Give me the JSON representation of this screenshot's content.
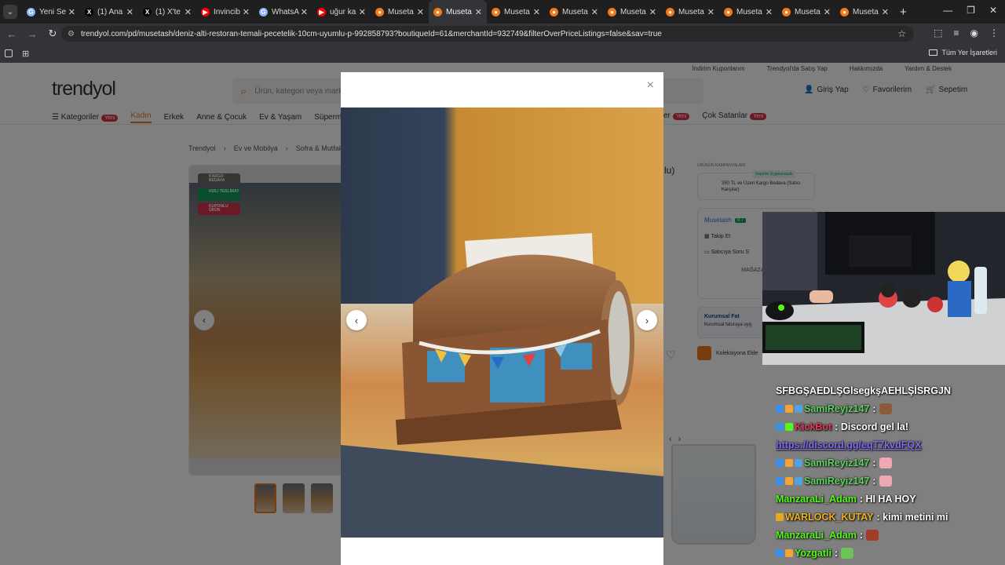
{
  "browser": {
    "tabs": [
      {
        "label": "Yeni Se",
        "fav_color": "#8ab4f8",
        "fav": "G"
      },
      {
        "label": "(1) Ana",
        "fav_color": "#000000",
        "fav": "X"
      },
      {
        "label": "(1) X'te",
        "fav_color": "#000000",
        "fav": "X"
      },
      {
        "label": "Invincib",
        "fav_color": "#ff0000",
        "fav": "▶"
      },
      {
        "label": "WhatsA",
        "fav_color": "#8ab4f8",
        "fav": "G"
      },
      {
        "label": "uğur ka",
        "fav_color": "#ff0000",
        "fav": "▶"
      },
      {
        "label": "Museta",
        "fav_color": "#f27a1a",
        "fav": "●"
      },
      {
        "label": "Museta",
        "fav_color": "#f27a1a",
        "fav": "●",
        "active": true
      },
      {
        "label": "Museta",
        "fav_color": "#f27a1a",
        "fav": "●"
      },
      {
        "label": "Museta",
        "fav_color": "#f27a1a",
        "fav": "●"
      },
      {
        "label": "Museta",
        "fav_color": "#f27a1a",
        "fav": "●"
      },
      {
        "label": "Museta",
        "fav_color": "#f27a1a",
        "fav": "●"
      },
      {
        "label": "Museta",
        "fav_color": "#f27a1a",
        "fav": "●"
      },
      {
        "label": "Museta",
        "fav_color": "#f27a1a",
        "fav": "●"
      },
      {
        "label": "Museta",
        "fav_color": "#f27a1a",
        "fav": "●"
      }
    ],
    "url": "trendyol.com/pd/musetash/deniz-alti-restoran-temali-pecetelik-10cm-uyumlu-p-992858793?boutiqueId=61&merchantId=932749&filterOverPriceListings=false&sav=true",
    "bookmark_all": "Tüm Yer İşaretleri"
  },
  "site": {
    "logo": "trendyol",
    "top_links": [
      "İndirim Kuponlarım",
      "Trendyol'da Satış Yap",
      "Hakkımızda",
      "Yardım & Destek"
    ],
    "search_placeholder": "Ürün, kategori veya marka",
    "user_links": {
      "login": "Giriş Yap",
      "favorites": "Favorilerim",
      "cart": "Sepetim"
    },
    "categories": {
      "all": "Kategoriler",
      "new_badge": "Yeni",
      "items": [
        "Kadın",
        "Erkek",
        "Anne & Çocuk",
        "Ev & Yaşam",
        "Süpermarket"
      ],
      "right_items": [
        "er",
        "Çok Satanlar"
      ]
    },
    "breadcrumb": [
      "Trendyol",
      "Ev ve Mobilya",
      "Sofra & Mutfak"
    ],
    "gallery_chips": [
      "KARGO BEDAVA",
      "HIZLI TESLİMAT",
      "KUPONLU ÜRÜN"
    ],
    "title_fragment": "lu)",
    "campaigns": {
      "heading": "ÜRÜNÜN KAMPANYALARI",
      "tag": "Sepette Uygulanacak",
      "text": "350 TL ve Üzeri Kargo Bedava (Satıcı Karşılar)"
    },
    "seller": {
      "name": "Musetash",
      "score": "9.7",
      "follow": "Takip Et",
      "ask": "Satıcıya Soru S",
      "store": "MAĞAZAYA"
    },
    "corporate": {
      "title": "Kurumsal Fat",
      "sub": "Kurumsal faturaya uyg"
    },
    "collection": "Koleksiyona Ekle"
  },
  "modal": {
    "close": "×",
    "prev": "‹",
    "next": "›"
  },
  "chat": [
    {
      "user": "",
      "text": "SFBGŞAEDLŞGlsegkşAEHLŞİSRGJN",
      "color": "#ffffff",
      "icons": []
    },
    {
      "user": "SamiReyiz147",
      "text": ":",
      "color": "#5fd35f",
      "icons": [
        "#3a8ee6",
        "#f2a33a",
        "#4fa3e0"
      ],
      "emote": "#8a5a3c"
    },
    {
      "user": "KickBot",
      "text": ": Discord gel la!",
      "color": "#e23a5a",
      "icons": [
        "#3a8ee6",
        "#53fc18"
      ]
    },
    {
      "user": "",
      "text": "https://discord.gg/eqT7kvdFQX",
      "color": "#7c6cf0",
      "link": true,
      "icons": []
    },
    {
      "user": "SamiReyiz147",
      "text": ":",
      "color": "#5fd35f",
      "icons": [
        "#3a8ee6",
        "#f2a33a",
        "#4fa3e0"
      ],
      "emote": "#f0a7b4"
    },
    {
      "user": "SamiReyiz147",
      "text": ":",
      "color": "#5fd35f",
      "icons": [
        "#3a8ee6",
        "#f2a33a",
        "#4fa3e0"
      ],
      "emote": "#f0a7b4"
    },
    {
      "user": "ManzaraLi_Adam",
      "text": ": HI HA HOY",
      "color": "#53fc18",
      "icons": []
    },
    {
      "user": "WARLOCK_KUTAY",
      "text": ": kimi metini mi",
      "color": "#f2b01e",
      "icons": [
        "#e6a81e"
      ]
    },
    {
      "user": "ManzaraLi_Adam",
      "text": ":",
      "color": "#53fc18",
      "icons": [],
      "emote": "#a33a2a"
    },
    {
      "user": "Yozgatli",
      "text": ":",
      "color": "#53fc18",
      "icons": [
        "#3a8ee6",
        "#f2a33a"
      ],
      "emote": "#6ac45a"
    }
  ]
}
